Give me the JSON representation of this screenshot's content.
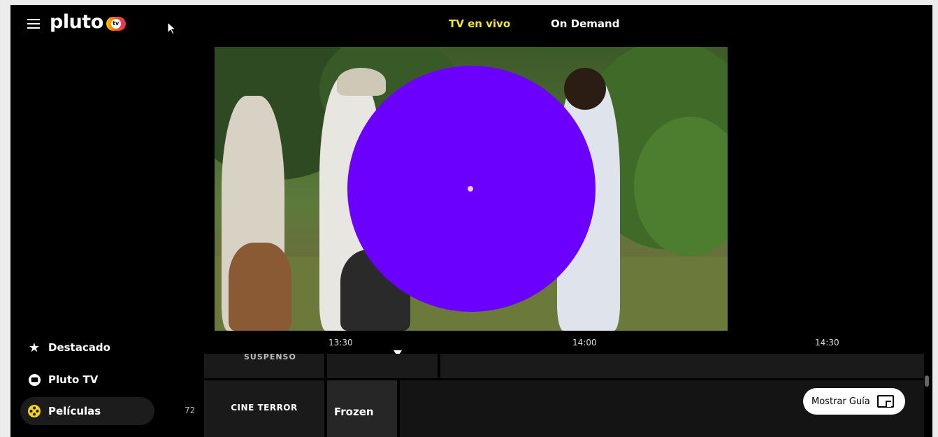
{
  "header": {
    "logo_text": "pluto",
    "logo_badge": "tv",
    "tabs": [
      {
        "label": "TV en vivo",
        "active": true
      },
      {
        "label": "On Demand",
        "active": false
      }
    ]
  },
  "sidebar": {
    "items": [
      {
        "label": "Destacado",
        "icon": "star-icon"
      },
      {
        "label": "Pluto TV",
        "icon": "pluto-tv-icon"
      },
      {
        "label": "Películas",
        "icon": "film-reel-icon",
        "active": true
      }
    ]
  },
  "guide": {
    "times": [
      "13:30",
      "14:00",
      "14:30"
    ],
    "channel_number": "72",
    "rows": [
      {
        "channel": "SUSPENSO",
        "program": ""
      },
      {
        "channel": "CINE TERROR",
        "program": "Frozen"
      }
    ],
    "show_guide_label": "Mostrar Guía"
  },
  "colors": {
    "accent_yellow": "#f4e62d",
    "play_disc": "#6b00ff"
  }
}
